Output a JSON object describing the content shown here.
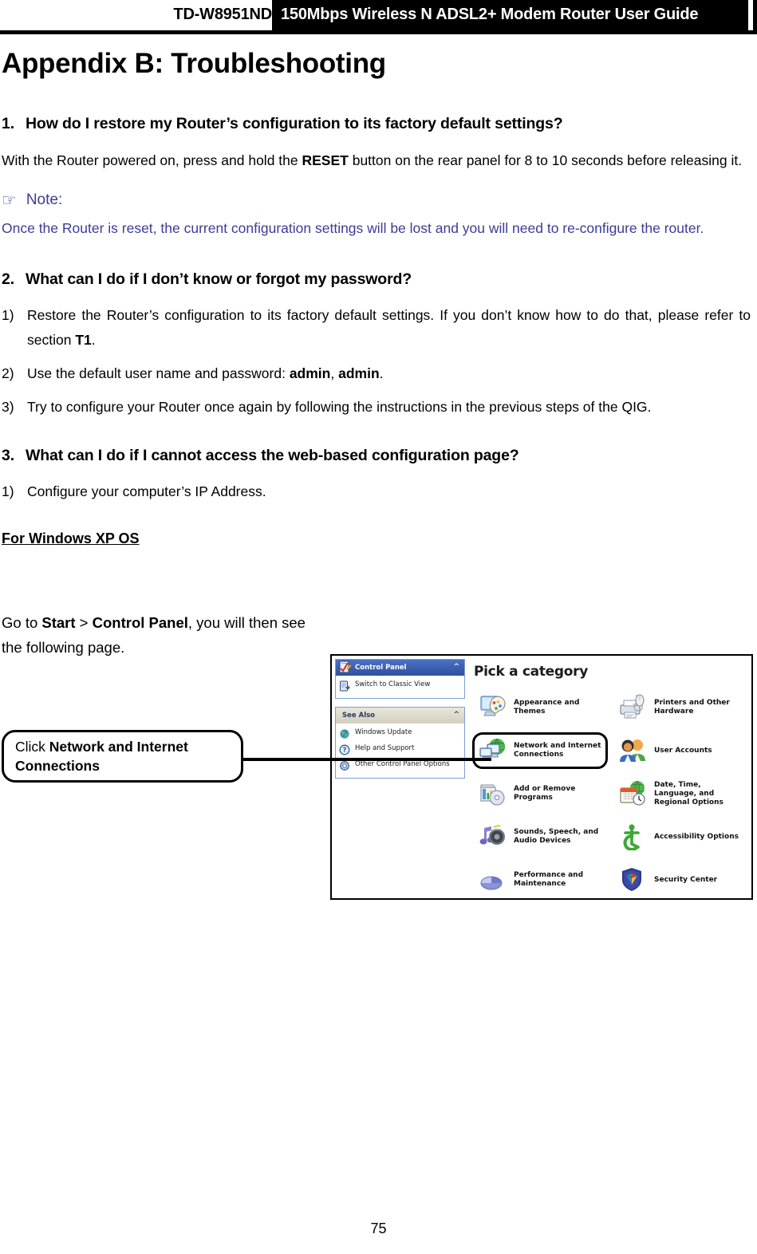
{
  "header": {
    "model": "TD-W8951ND",
    "title": "150Mbps Wireless N ADSL2+ Modem Router User Guide"
  },
  "appendix_title": "Appendix B: Troubleshooting",
  "sections": [
    {
      "number": "1.",
      "heading": "How do I restore my Router’s configuration to its factory default settings?",
      "paragraph_pre": "With the Router powered on, press and hold the ",
      "paragraph_bold": "RESET",
      "paragraph_post": " button on the rear panel for 8 to 10 seconds before releasing it.",
      "note_label": "Note:",
      "note_icon": "pointing-hand-icon",
      "note_body": "Once the Router is reset, the current configuration settings will be lost and you will need to re-configure the router.",
      "note_color": "#3c3c96"
    },
    {
      "number": "2.",
      "heading": "What can I do if I don’t know or forgot my password?",
      "items": [
        {
          "marker": "1)",
          "pre": "Restore the Router’s configuration to its factory default settings. If you don’t know how to do that, please refer to section ",
          "bold": "T1",
          "post": "."
        },
        {
          "marker": "2)",
          "pre": "Use the default user name and password: ",
          "bold": "admin",
          "mid": ", ",
          "bold2": "admin",
          "post": "."
        },
        {
          "marker": "3)",
          "pre": "Try to configure your Router once again by following the instructions in the previous steps of the QIG.",
          "bold": "",
          "post": ""
        }
      ]
    },
    {
      "number": "3.",
      "heading": "What can I do if I cannot access the web-based configuration page?",
      "items": [
        {
          "marker": "1)",
          "pre": "Configure your computer’s IP Address.",
          "bold": "",
          "post": ""
        }
      ],
      "subheading": "For Windows XP OS"
    }
  ],
  "instruction": {
    "pre": "Go to ",
    "bold1": "Start",
    "sep": " > ",
    "bold2": "Control Panel",
    "post": ", you will then see the following page."
  },
  "callout": {
    "pre": "Click ",
    "bold": "Network and Internet Connections"
  },
  "control_panel": {
    "sidebar": {
      "panel1": {
        "header": "Control Panel",
        "header_icon": "control-panel-icon",
        "collapse_icon": "chevron-up-icon",
        "links": [
          {
            "label": "Switch to Classic View",
            "icon": "classic-view-icon"
          }
        ]
      },
      "panel2": {
        "header": "See Also",
        "collapse_icon": "chevron-up-icon",
        "links": [
          {
            "label": "Windows Update",
            "icon": "windows-update-icon"
          },
          {
            "label": "Help and Support",
            "icon": "help-support-icon"
          },
          {
            "label": "Other Control Panel Options",
            "icon": "other-options-icon"
          }
        ]
      }
    },
    "main_title": "Pick a category",
    "categories": [
      {
        "label": "Appearance and Themes",
        "icon": "appearance-themes-icon",
        "highlighted": false
      },
      {
        "label": "Printers and Other Hardware",
        "icon": "printers-hardware-icon",
        "highlighted": false
      },
      {
        "label": "Network and Internet Connections",
        "icon": "network-internet-icon",
        "highlighted": true
      },
      {
        "label": "User Accounts",
        "icon": "user-accounts-icon",
        "highlighted": false
      },
      {
        "label": "Add or Remove Programs",
        "icon": "add-remove-programs-icon",
        "highlighted": false
      },
      {
        "label": "Date, Time, Language, and Regional Options",
        "icon": "date-time-language-icon",
        "highlighted": false
      },
      {
        "label": "Sounds, Speech, and Audio Devices",
        "icon": "sounds-speech-audio-icon",
        "highlighted": false
      },
      {
        "label": "Accessibility Options",
        "icon": "accessibility-options-icon",
        "highlighted": false
      },
      {
        "label": "Performance and Maintenance",
        "icon": "performance-maintenance-icon",
        "highlighted": false
      },
      {
        "label": "Security Center",
        "icon": "security-center-icon",
        "highlighted": false
      }
    ]
  },
  "page_number": "75"
}
